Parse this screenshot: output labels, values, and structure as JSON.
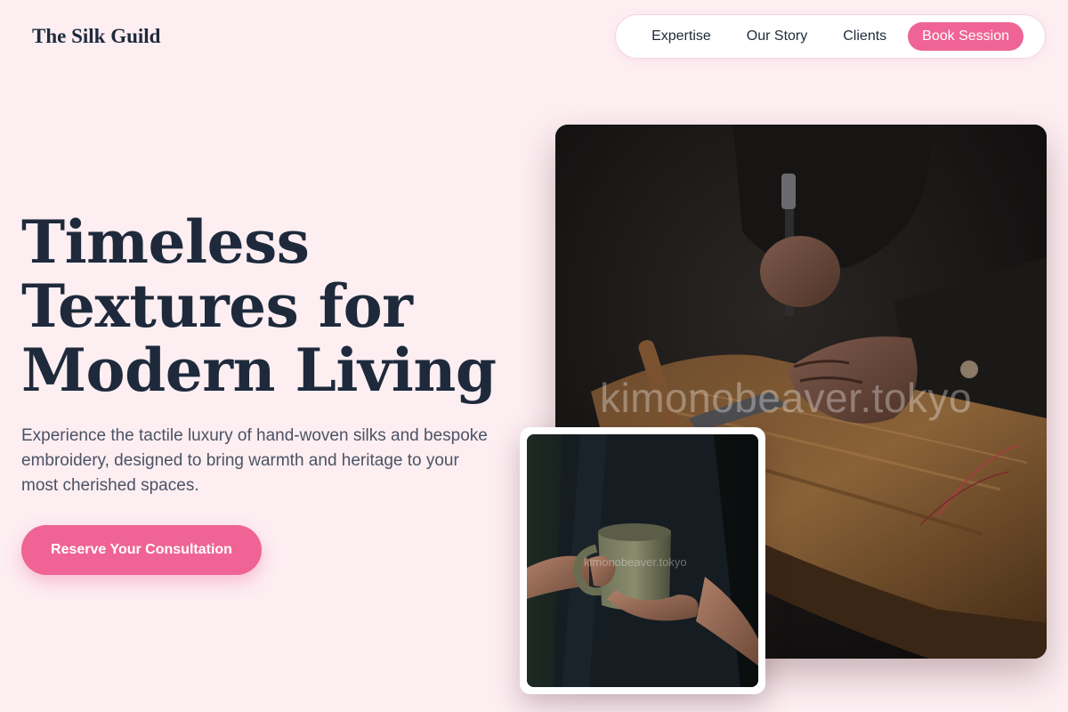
{
  "brand": {
    "name": "The Silk Guild"
  },
  "nav": {
    "items": [
      {
        "label": "Expertise"
      },
      {
        "label": "Our Story"
      },
      {
        "label": "Clients"
      }
    ],
    "cta_label": "Book Session"
  },
  "hero": {
    "title_lines": [
      "Timeless",
      "Textures for",
      "Modern Living"
    ],
    "subtitle": "Experience the tactile luxury of hand-woven silks and bespoke embroidery, designed to bring warmth and heritage to your most cherished spaces.",
    "button_label": "Reserve Your Consultation"
  },
  "images": {
    "main": {
      "watermark": "kimonobeaver.tokyo",
      "icon": "craftsman-hammering-wood-photo"
    },
    "thumb": {
      "watermark": "kimonobeaver.tokyo",
      "icon": "hands-holding-ceramic-mug-photo"
    }
  },
  "colors": {
    "background": "#fdeef2",
    "accent": "#ef6495",
    "text_dark": "#1e2a3b",
    "text_muted": "#4a5364"
  }
}
